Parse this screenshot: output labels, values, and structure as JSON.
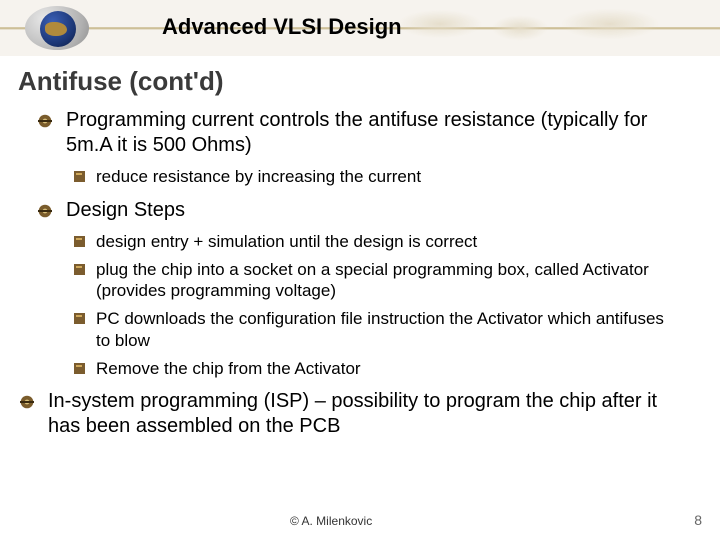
{
  "header": {
    "course_title": "Advanced VLSI Design"
  },
  "slide_title": "Antifuse (cont'd)",
  "bullets": {
    "b1_1": "Programming current controls the antifuse resistance (typically for 5m.A it is 500 Ohms)",
    "b1_1_sub1": "reduce resistance by increasing the current",
    "b1_2": "Design Steps",
    "b1_2_sub1": "design entry + simulation until the design is correct",
    "b1_2_sub2": "plug the chip into a socket on a special programming box, called Activator (provides programming voltage)",
    "b1_2_sub3": "PC downloads the configuration file instruction the Activator which antifuses to blow",
    "b1_2_sub4": "Remove the chip from the Activator",
    "b1_3": "In-system programming (ISP) – possibility to program the chip after it has been assembled on the PCB"
  },
  "footer": {
    "copyright": "©  A. Milenkovic",
    "page_number": "8"
  }
}
